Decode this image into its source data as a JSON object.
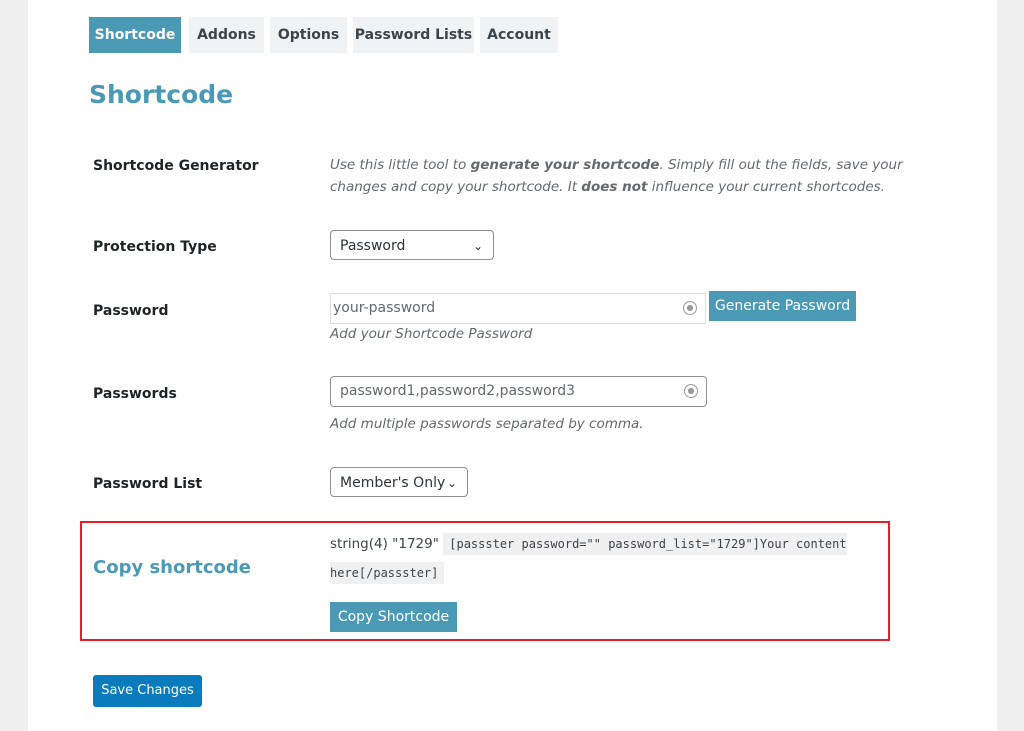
{
  "tabs": [
    {
      "label": "Shortcode",
      "active": true
    },
    {
      "label": "Addons"
    },
    {
      "label": "Options"
    },
    {
      "label": "Password Lists"
    },
    {
      "label": "Account"
    }
  ],
  "page_title": "Shortcode",
  "generator": {
    "label": "Shortcode Generator",
    "desc_1": "Use this little tool to ",
    "desc_bold_1": "generate your shortcode",
    "desc_2": ". Simply fill out the fields, save your changes and copy your shortcode. It ",
    "desc_bold_2": "does not",
    "desc_3": " influence your current shortcodes."
  },
  "protection_type": {
    "label": "Protection Type",
    "value": "Password"
  },
  "password": {
    "label": "Password",
    "placeholder": "your-password",
    "button": "Generate Password",
    "desc": "Add your Shortcode Password"
  },
  "passwords": {
    "label": "Passwords",
    "placeholder": "password1,password2,password3",
    "desc": "Add multiple passwords separated by comma."
  },
  "password_list": {
    "label": "Password List",
    "value": "Member's Only"
  },
  "copy": {
    "label": "Copy shortcode",
    "debug": "string(4) \"1729\"",
    "shortcode": "[passster password=\"\" password_list=\"1729\"]Your content here[/passster]",
    "button": "Copy Shortcode",
    "highlight_color": "#e0202a"
  },
  "save_button": "Save Changes"
}
